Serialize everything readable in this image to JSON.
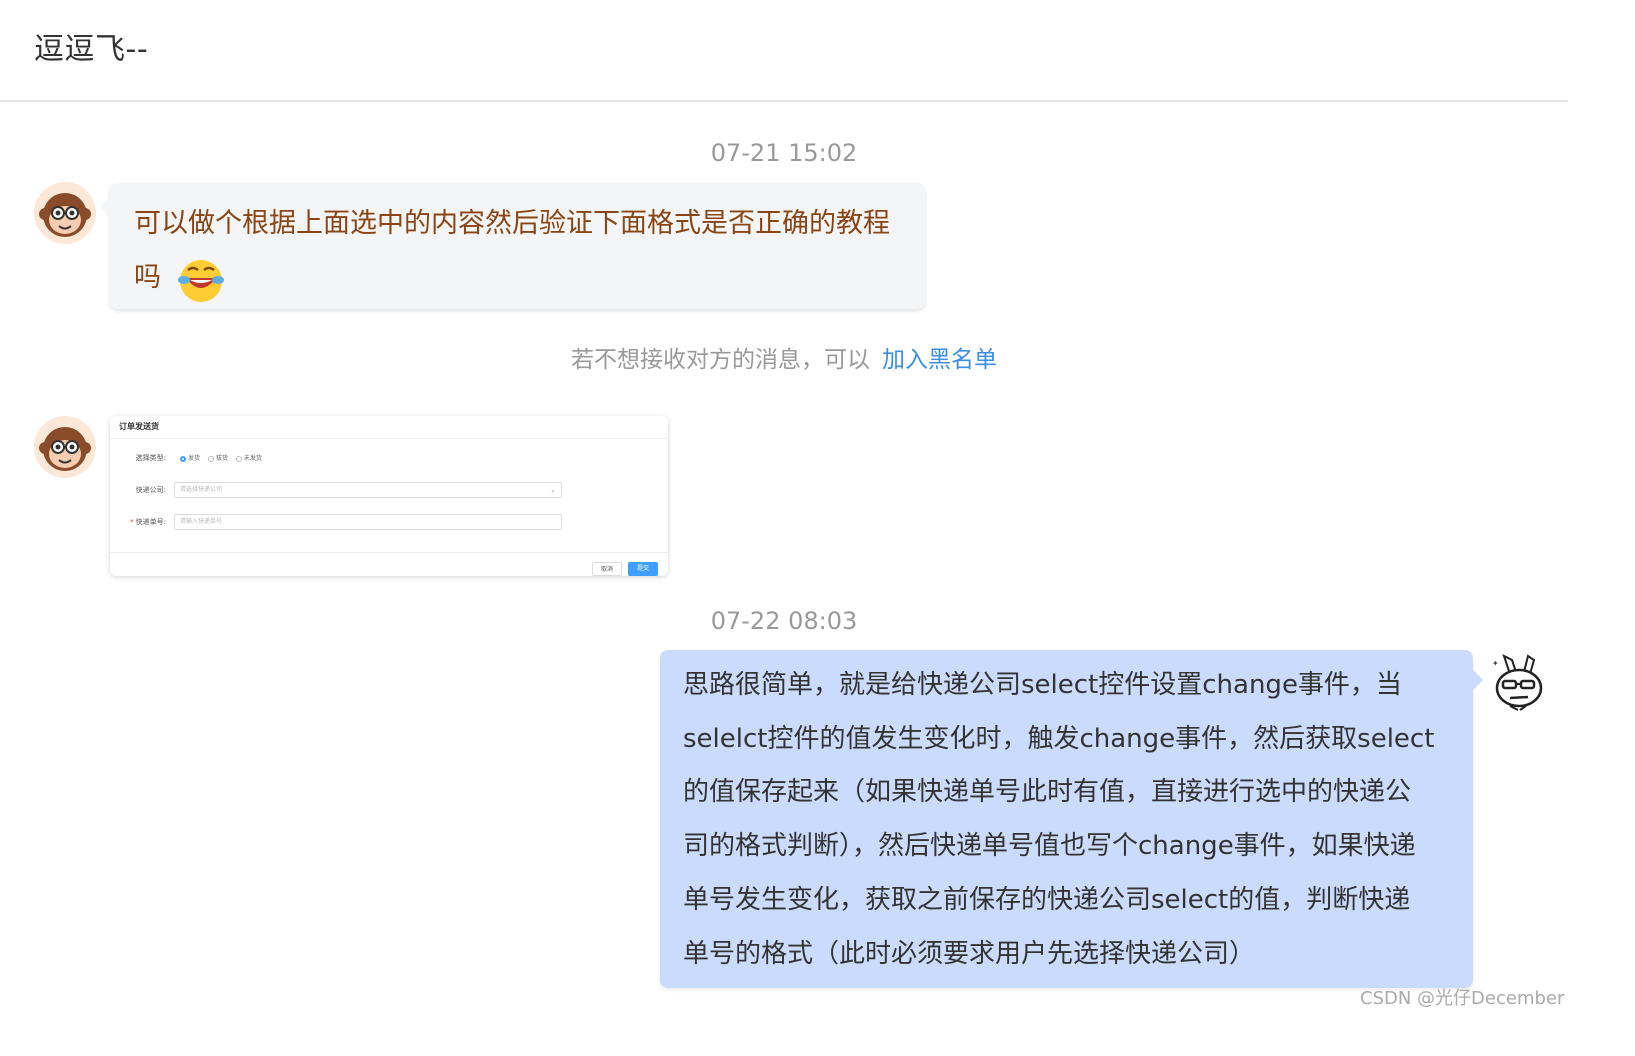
{
  "header": {
    "title": "逗逗飞--"
  },
  "messages": {
    "ts1": "07-21 15:02",
    "m1": {
      "line1": "可以做个根据上面选中的内容然后验证下面格式是否正确的教程",
      "line2": "吗",
      "emoji": "laughing-crying-emoji"
    },
    "notice": {
      "text": "若不想接收对方的消息，可以",
      "link": "加入黑名单"
    },
    "screenshot": {
      "title": "订单发送货",
      "type_label": "选择类型:",
      "options": [
        "发货",
        "拔货",
        "未发货"
      ],
      "company_label": "快递公司:",
      "company_placeholder": "请选择快递公司",
      "number_label": "快递单号:",
      "number_placeholder": "请输入快递单号",
      "cancel": "取消",
      "submit": "提交"
    },
    "ts2": "07-22 08:03",
    "m2": {
      "lines": [
        "思路很简单，就是给快递公司select控件设置change事件，当",
        "selelct控件的值发生变化时，触发change事件，然后获取select",
        "的值保存起来（如果快递单号此时有值，直接进行选中的快递公",
        "司的格式判断），然后快递单号值也写个change事件，如果快递",
        "单号发生变化，获取之前保存的快递公司select的值，判断快递",
        "单号的格式（此时必须要求用户先选择快递公司）"
      ]
    }
  },
  "watermark": "CSDN @光仔December",
  "colors": {
    "link": "#3a8ee6",
    "self_bubble": "#cadbfd",
    "other_bubble": "#f4f5f7",
    "other_text": "#8b4513"
  }
}
